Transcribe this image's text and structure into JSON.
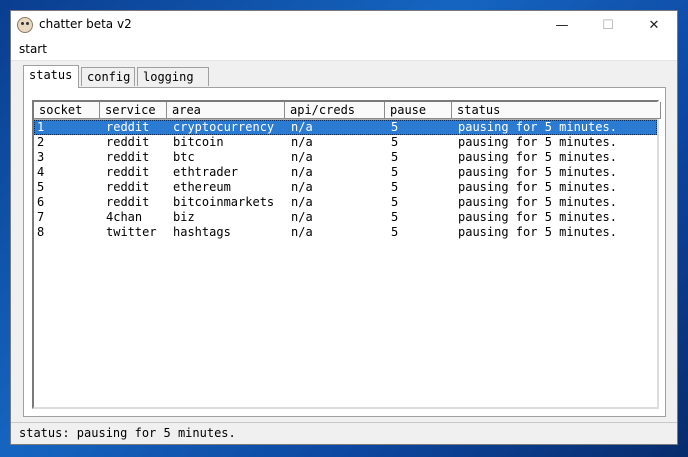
{
  "window": {
    "title": "chatter beta v2",
    "controls": {
      "minimize": "—",
      "maximize": "☐",
      "close": "✕"
    }
  },
  "menu": {
    "start": "start"
  },
  "tabs": [
    {
      "label": "status",
      "active": true
    },
    {
      "label": "config",
      "active": false
    },
    {
      "label": "logging",
      "active": false
    }
  ],
  "table": {
    "columns": [
      "socket",
      "service",
      "area",
      "api/creds",
      "pause",
      "status"
    ],
    "rows": [
      {
        "socket": "1",
        "service": "reddit",
        "area": "cryptocurrency",
        "api": "n/a",
        "pause": "5",
        "status": "pausing for 5 minutes.",
        "selected": true
      },
      {
        "socket": "2",
        "service": "reddit",
        "area": "bitcoin",
        "api": "n/a",
        "pause": "5",
        "status": "pausing for 5 minutes."
      },
      {
        "socket": "3",
        "service": "reddit",
        "area": "btc",
        "api": "n/a",
        "pause": "5",
        "status": "pausing for 5 minutes."
      },
      {
        "socket": "4",
        "service": "reddit",
        "area": "ethtrader",
        "api": "n/a",
        "pause": "5",
        "status": "pausing for 5 minutes."
      },
      {
        "socket": "5",
        "service": "reddit",
        "area": "ethereum",
        "api": "n/a",
        "pause": "5",
        "status": "pausing for 5 minutes."
      },
      {
        "socket": "6",
        "service": "reddit",
        "area": "bitcoinmarkets",
        "api": "n/a",
        "pause": "5",
        "status": "pausing for 5 minutes."
      },
      {
        "socket": "7",
        "service": "4chan",
        "area": "biz",
        "api": "n/a",
        "pause": "5",
        "status": "pausing for 5 minutes."
      },
      {
        "socket": "8",
        "service": "twitter",
        "area": "hashtags",
        "api": "n/a",
        "pause": "5",
        "status": "pausing for 5 minutes."
      }
    ]
  },
  "statusbar": {
    "text": "status: pausing for 5 minutes."
  },
  "colors": {
    "selection": "#2c7bd3",
    "desktop": "#1565c0"
  }
}
